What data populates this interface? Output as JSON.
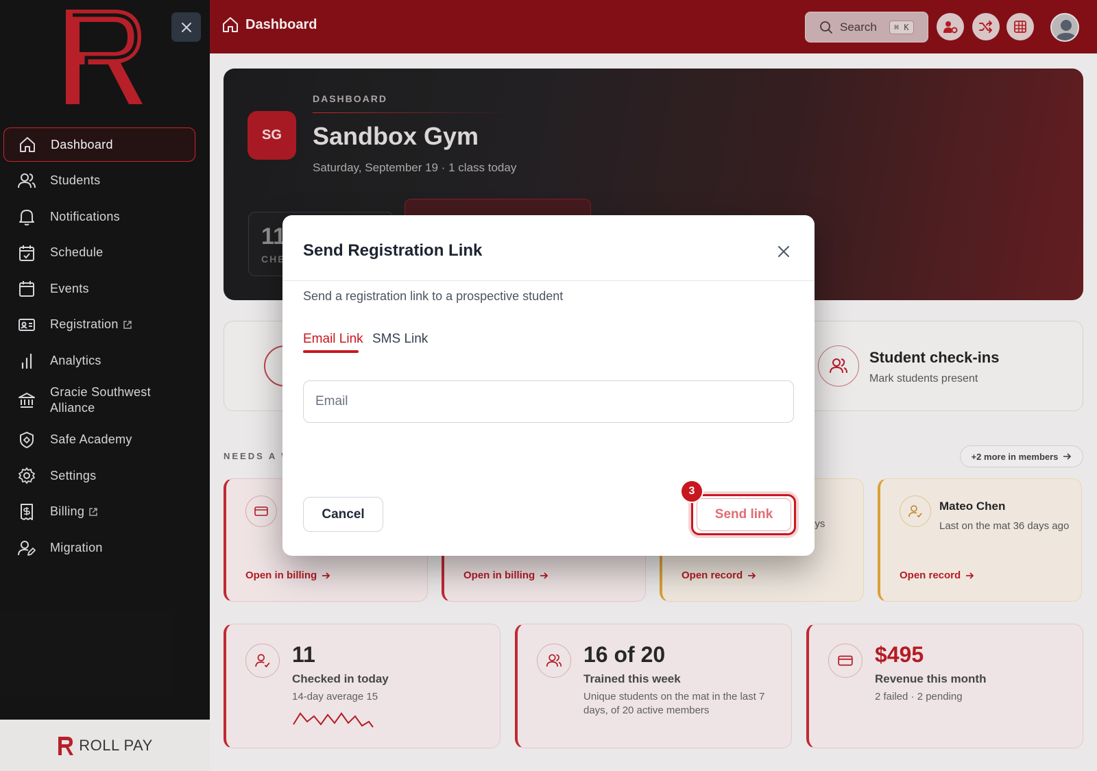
{
  "sidebar": {
    "brand": "ROLL PAY",
    "items": [
      {
        "label": "Dashboard",
        "icon": "home-icon",
        "active": true
      },
      {
        "label": "Students",
        "icon": "users-icon"
      },
      {
        "label": "Notifications",
        "icon": "bell-icon"
      },
      {
        "label": "Schedule",
        "icon": "calendar-check-icon"
      },
      {
        "label": "Events",
        "icon": "calendar-icon"
      },
      {
        "label": "Registration",
        "icon": "id-card-icon",
        "external": true
      },
      {
        "label": "Analytics",
        "icon": "bar-chart-icon"
      },
      {
        "label": "Gracie Southwest Alliance",
        "icon": "bank-icon"
      },
      {
        "label": "Safe Academy",
        "icon": "shield-icon"
      },
      {
        "label": "Settings",
        "icon": "gear-icon"
      },
      {
        "label": "Billing",
        "icon": "receipt-icon",
        "external": true
      },
      {
        "label": "Migration",
        "icon": "user-edit-icon"
      }
    ]
  },
  "header": {
    "title": "Dashboard",
    "search_label": "Search",
    "search_shortcut": "⌘ K"
  },
  "hero": {
    "kicker": "DASHBOARD",
    "initials": "SG",
    "title": "Sandbox Gym",
    "subtitle": "Saturday, September 19 · 1 class today",
    "stat_value": "11",
    "stat_label": "CHE"
  },
  "quick_action": {
    "title": "Student check-ins",
    "subtitle": "Mark students present"
  },
  "needs": {
    "heading": "NEEDS A WO",
    "more_label": "+2 more in members",
    "cards": [
      {
        "link": "Open in billing",
        "icon": "credit-card-icon"
      },
      {
        "link": "Open in billing"
      },
      {
        "link": "Open record",
        "fragment": "ays"
      },
      {
        "name": "Mateo Chen",
        "desc": "Last on the mat 36 days ago",
        "link": "Open record",
        "icon": "user-check-icon"
      }
    ]
  },
  "kpis": [
    {
      "value": "11",
      "title": "Checked in today",
      "desc": "14-day average 15",
      "icon": "user-check-icon"
    },
    {
      "value": "16 of 20",
      "title": "Trained this week",
      "desc": "Unique students on the mat in the last 7 days, of 20 active members",
      "icon": "users-icon"
    },
    {
      "value": "$495",
      "title": "Revenue this month",
      "desc": "2 failed · 2 pending",
      "icon": "credit-card-icon"
    }
  ],
  "modal": {
    "title": "Send Registration Link",
    "subtitle": "Send a registration link to a prospective student",
    "tabs": [
      {
        "label": "Email Link",
        "active": true
      },
      {
        "label": "SMS Link"
      }
    ],
    "email_placeholder": "Email",
    "cancel_label": "Cancel",
    "send_label": "Send link",
    "step_badge": "3"
  },
  "colors": {
    "brand": "#c8171f",
    "header": "#7c0008",
    "sidebar": "#060606"
  }
}
